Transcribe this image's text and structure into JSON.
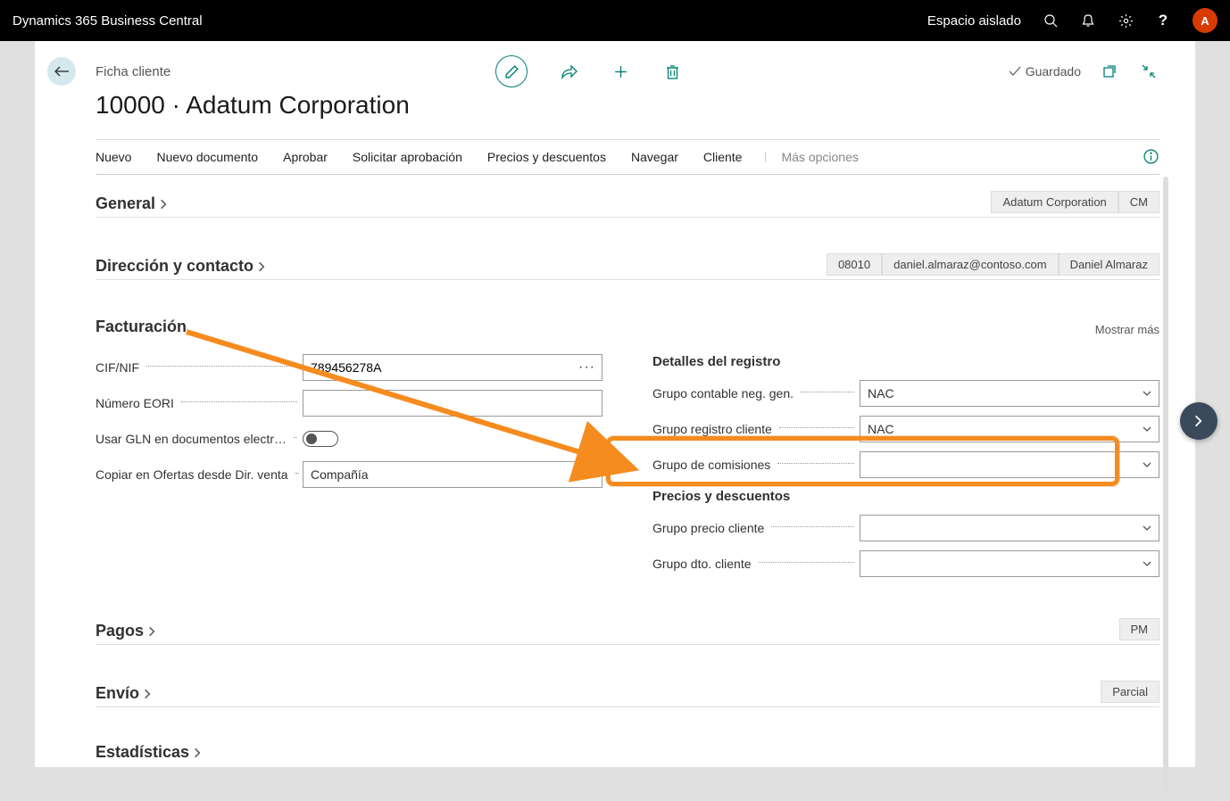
{
  "topbar": {
    "product": "Dynamics 365 Business Central",
    "environment": "Espacio aislado",
    "avatar_letter": "A"
  },
  "header": {
    "crumb": "Ficha cliente",
    "title": "10000 · Adatum Corporation",
    "saved_label": "Guardado"
  },
  "actions": {
    "a1": "Nuevo",
    "a2": "Nuevo documento",
    "a3": "Aprobar",
    "a4": "Solicitar aprobación",
    "a5": "Precios y descuentos",
    "a6": "Navegar",
    "a7": "Cliente",
    "more": "Más opciones"
  },
  "sections": {
    "general": {
      "title": "General",
      "badge1": "Adatum Corporation",
      "badge2": "CM"
    },
    "address": {
      "title": "Dirección y contacto",
      "badge1": "08010",
      "badge2": "daniel.almaraz@contoso.com",
      "badge3": "Daniel Almaraz"
    },
    "billing": {
      "title": "Facturación",
      "show_more": "Mostrar más",
      "left": {
        "cif_label": "CIF/NIF",
        "cif_value": "789456278A",
        "eori_label": "Número EORI",
        "eori_value": "",
        "gln_label": "Usar GLN en documentos electr…",
        "copy_label": "Copiar en Ofertas desde Dir. venta",
        "copy_value": "Compañía"
      },
      "right": {
        "heading1": "Detalles del registro",
        "gbpg_label": "Grupo contable neg. gen.",
        "gbpg_value": "NAC",
        "cpg_label": "Grupo registro cliente",
        "cpg_value": "NAC",
        "comm_label": "Grupo de comisiones",
        "comm_value": "",
        "heading2": "Precios y descuentos",
        "price_label": "Grupo precio cliente",
        "price_value": "",
        "disc_label": "Grupo dto. cliente",
        "disc_value": ""
      }
    },
    "payments": {
      "title": "Pagos",
      "badge1": "PM"
    },
    "shipping": {
      "title": "Envío",
      "badge1": "Parcial"
    },
    "stats": {
      "title": "Estadísticas"
    }
  }
}
